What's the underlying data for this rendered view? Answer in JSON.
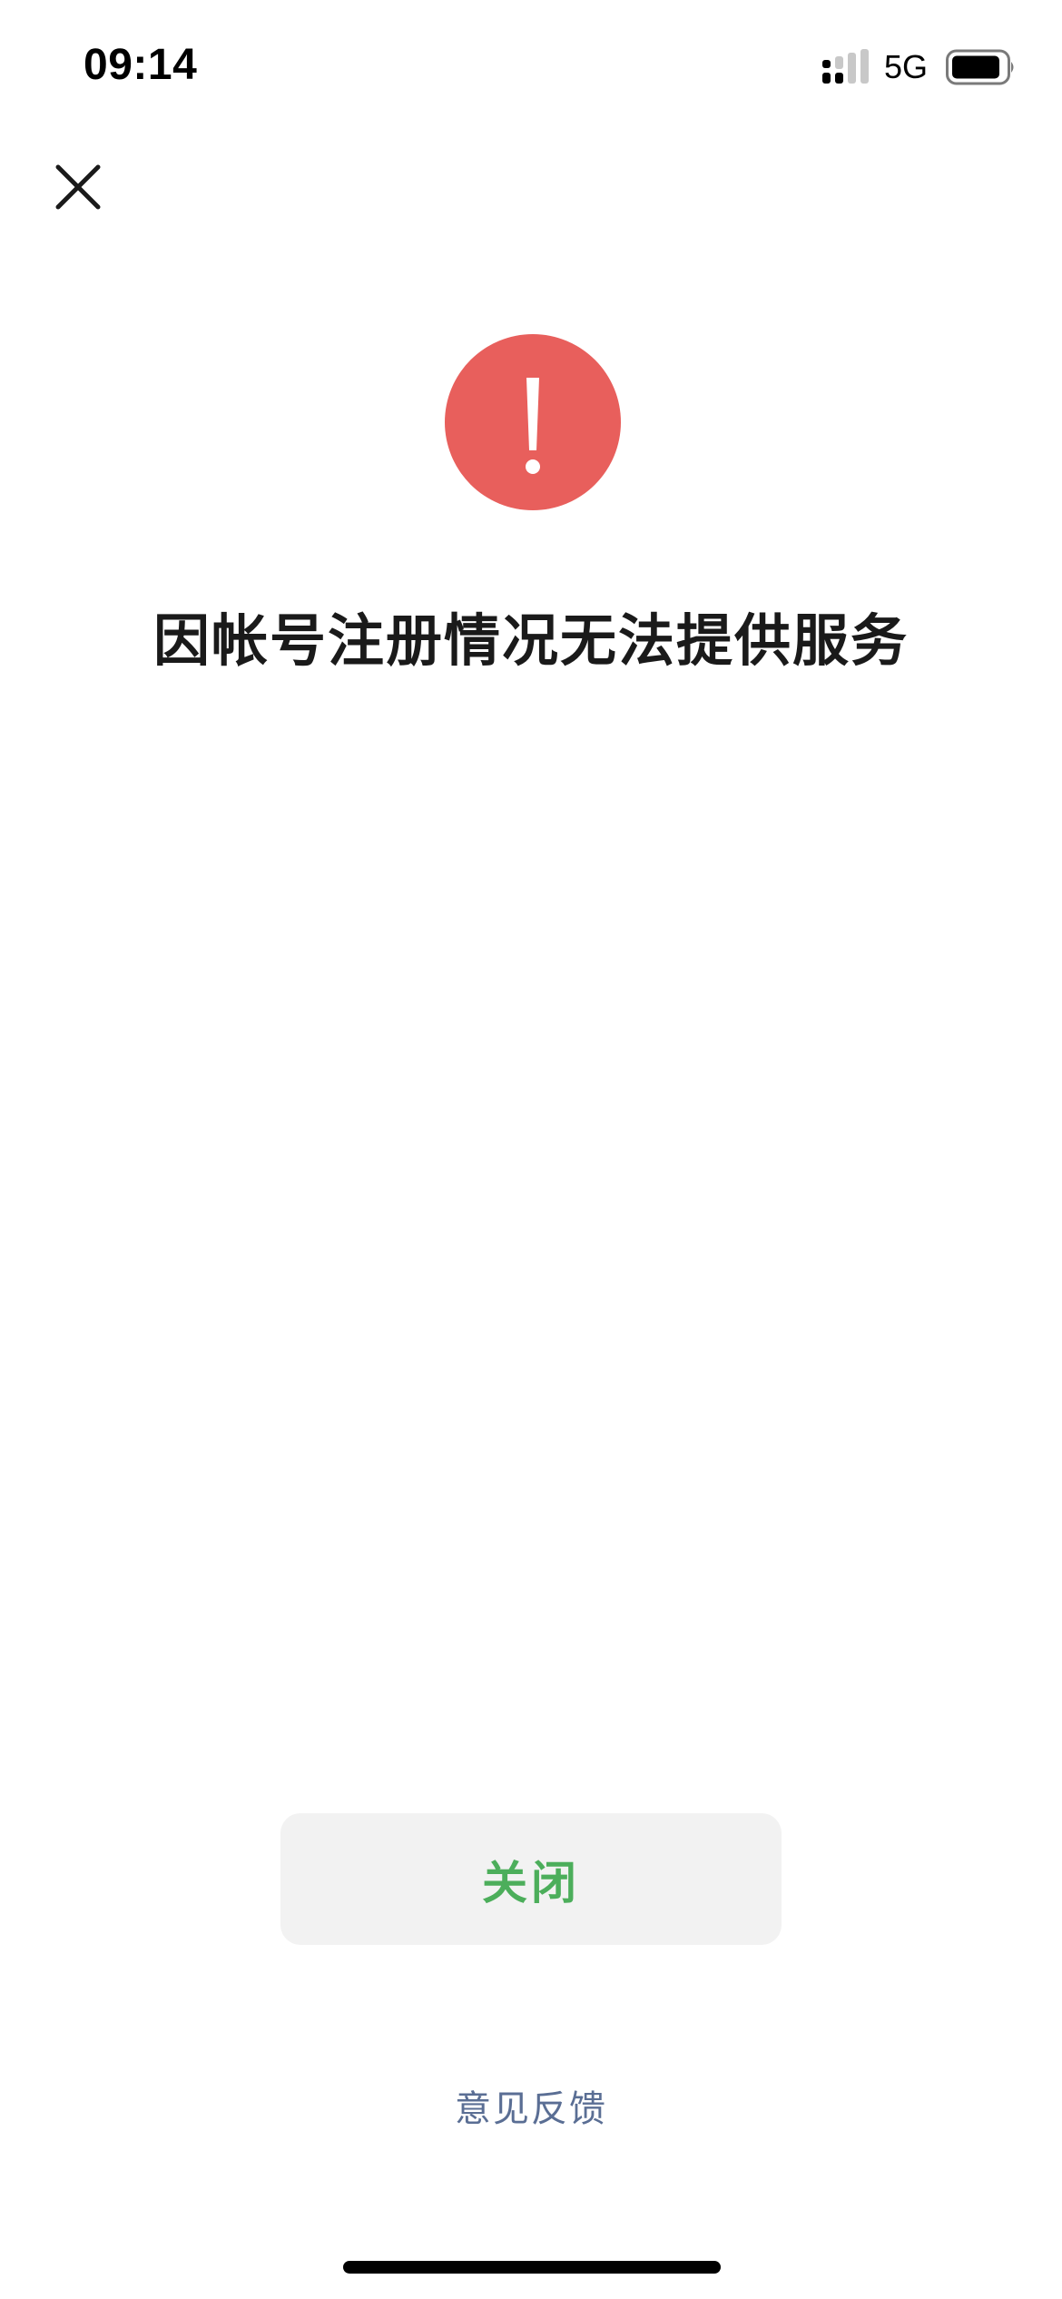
{
  "status_bar": {
    "time": "09:14",
    "network": "5G",
    "icons": [
      "signal-icon",
      "battery-icon"
    ]
  },
  "toolbar": {
    "close_icon": "close-icon"
  },
  "alert": {
    "icon": "warning-icon",
    "icon_color": "#e85f5c",
    "message": "因帐号注册情况无法提供服务"
  },
  "actions": {
    "close_label": "关闭",
    "close_color": "#4cae5b",
    "feedback_label": "意见反馈",
    "feedback_color": "#5a6e94"
  }
}
